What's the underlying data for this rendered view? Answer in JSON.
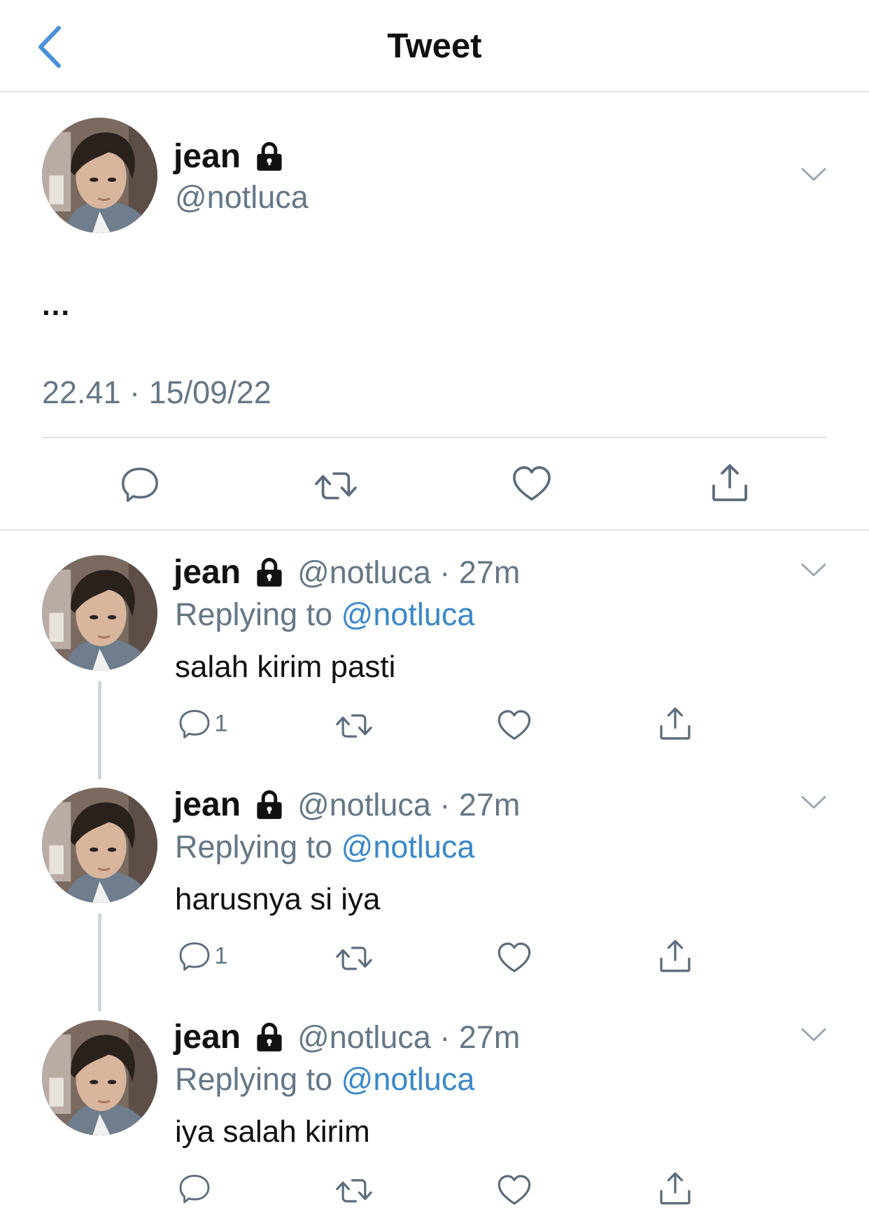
{
  "header": {
    "title": "Tweet"
  },
  "main_tweet": {
    "name": "jean",
    "handle": "@notluca",
    "text": "...",
    "timestamp": "22.41 · 15/09/22"
  },
  "replies": [
    {
      "name": "jean",
      "handle": "@notluca",
      "time": "27m",
      "replying_label": "Replying to",
      "replying_to": "@notluca",
      "text": "salah kirim pasti",
      "reply_count": "1"
    },
    {
      "name": "jean",
      "handle": "@notluca",
      "time": "27m",
      "replying_label": "Replying to",
      "replying_to": "@notluca",
      "text": "harusnya si iya",
      "reply_count": "1"
    },
    {
      "name": "jean",
      "handle": "@notluca",
      "time": "27m",
      "replying_label": "Replying to",
      "replying_to": "@notluca",
      "text": "iya salah kirim",
      "reply_count": ""
    }
  ],
  "icons": {
    "back": "chevron-left-icon",
    "more": "chevron-down-icon",
    "lock": "lock-icon",
    "reply": "comment-icon",
    "retweet": "retweet-icon",
    "like": "heart-icon",
    "share": "share-icon"
  },
  "colors": {
    "accent": "#4a90d9",
    "muted": "#657786",
    "divider": "#dfe3e6"
  }
}
